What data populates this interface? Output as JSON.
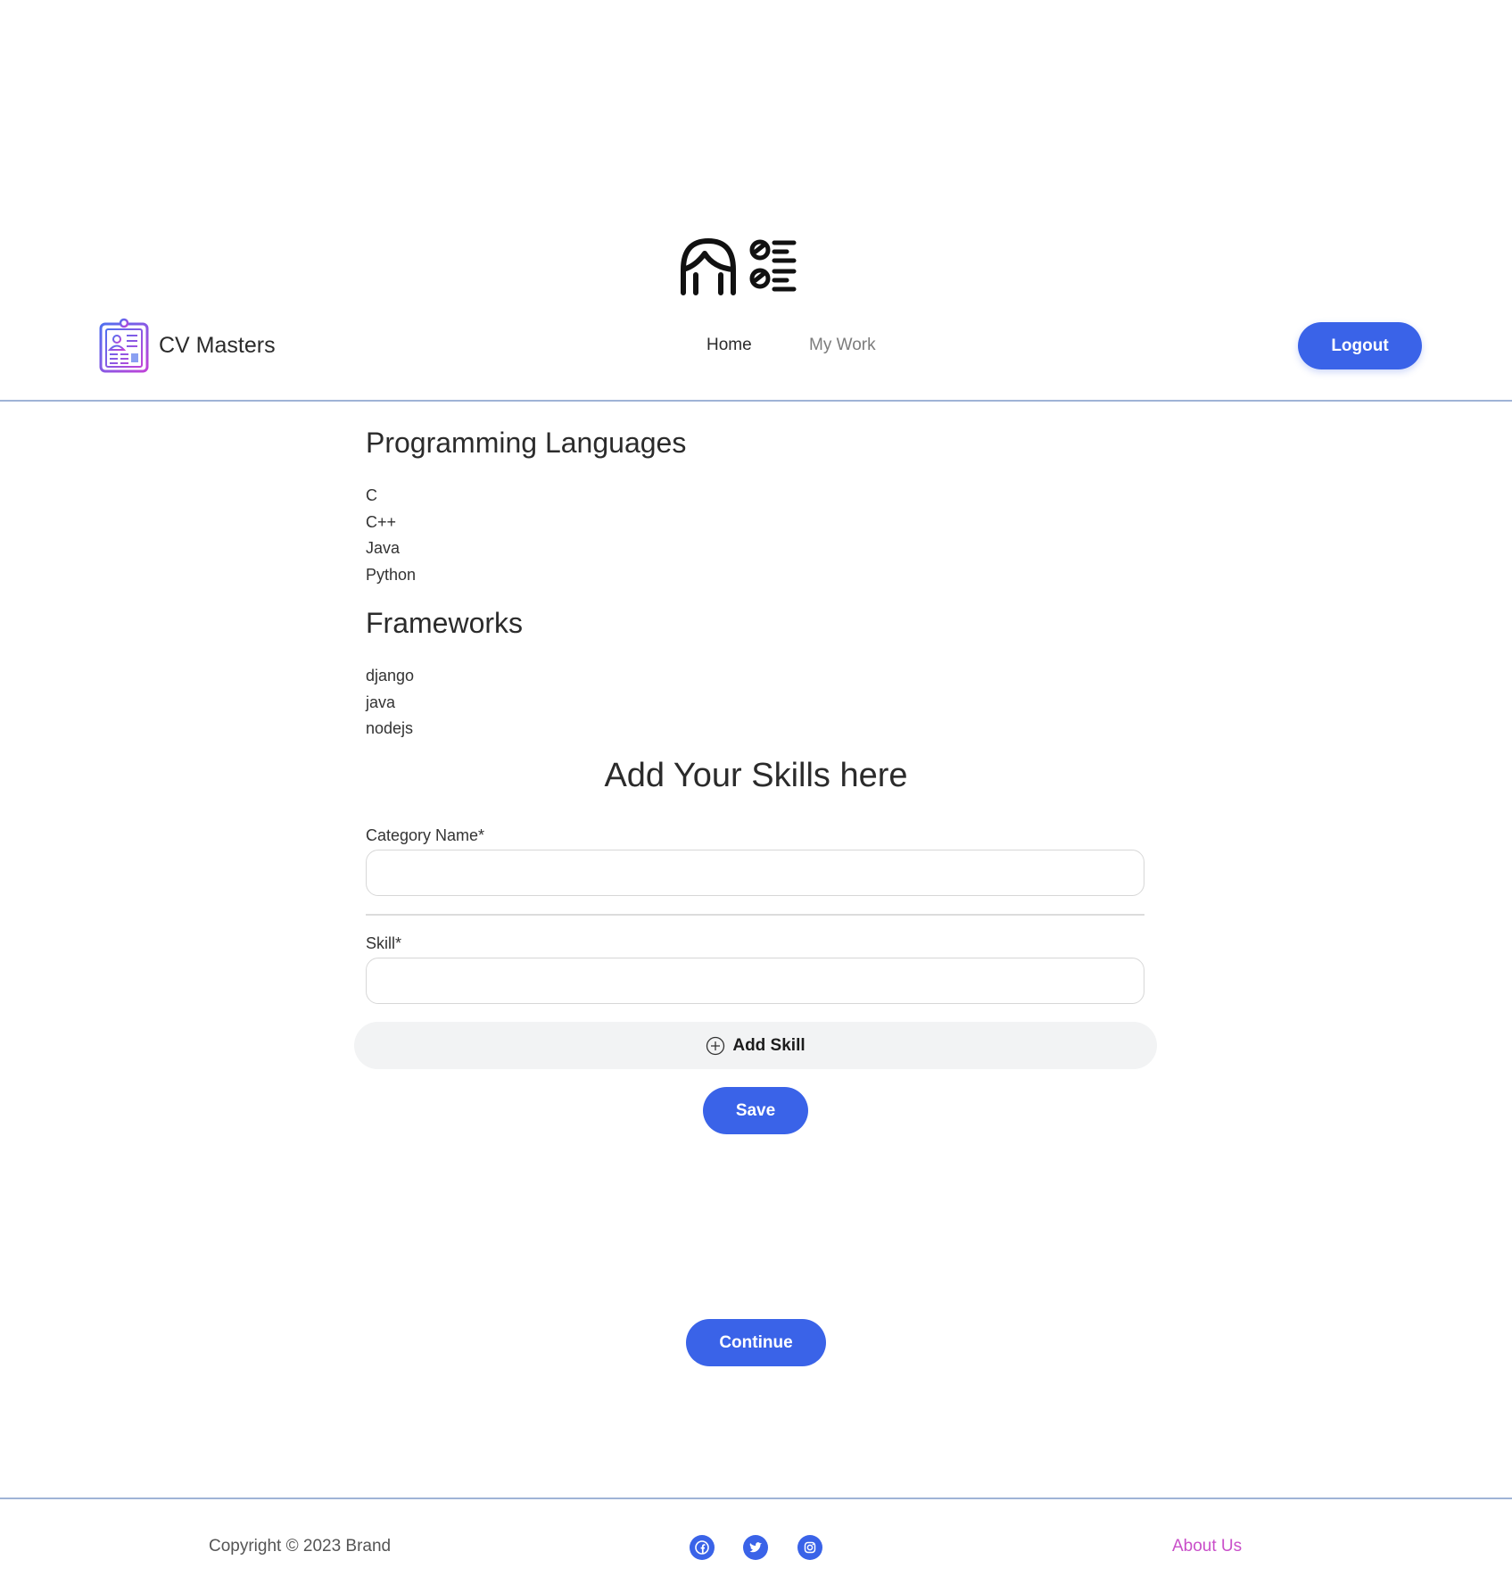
{
  "brand": {
    "name": "CV Masters",
    "logo_icon": "resume-clipboard-icon"
  },
  "hero": {
    "icon": "person-checklist-icon"
  },
  "nav": {
    "home": "Home",
    "my_work": "My Work",
    "logout": "Logout"
  },
  "categories": [
    {
      "title": "Programming Languages",
      "skills": [
        "C",
        "C++",
        "Java",
        "Python"
      ]
    },
    {
      "title": "Frameworks",
      "skills": [
        "django",
        "java",
        "nodejs"
      ]
    }
  ],
  "form": {
    "title": "Add Your Skills here",
    "category_label": "Category Name*",
    "category_value": "",
    "skill_label": "Skill*",
    "skill_value": "",
    "add_skill": "Add Skill",
    "save": "Save"
  },
  "continue_label": "Continue",
  "footer": {
    "copyright": "Copyright © 2023 Brand",
    "social_icons": [
      "facebook-icon",
      "twitter-icon",
      "instagram-icon"
    ],
    "about": "About Us"
  },
  "colors": {
    "primary": "#3a63e8",
    "accent_link": "#c94fc9",
    "divider": "#9fb3d6"
  }
}
